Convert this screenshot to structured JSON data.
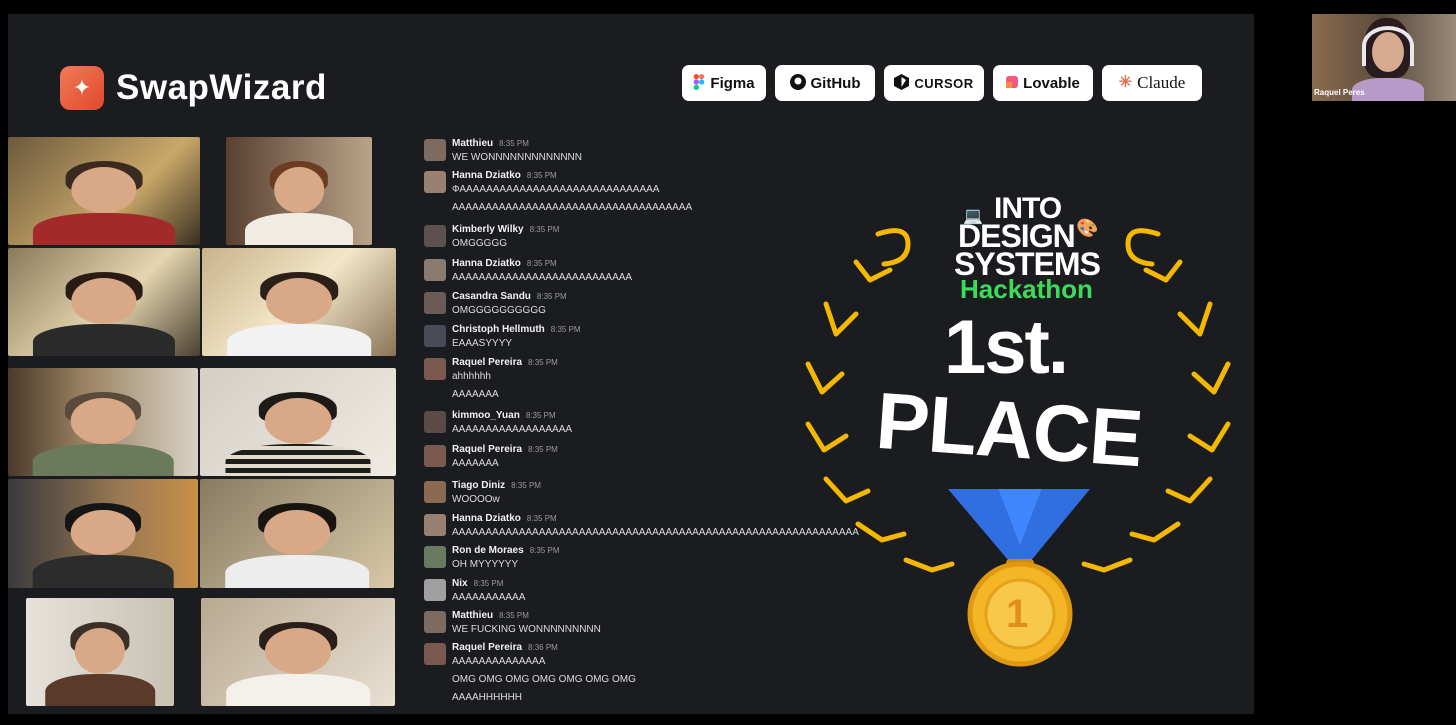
{
  "brand": {
    "name": "SwapWizard",
    "logo_icon": "magic-wand-icon",
    "accent": "#e8583a"
  },
  "sponsors": [
    {
      "label": "Figma",
      "icon": "figma-icon"
    },
    {
      "label": "GitHub",
      "icon": "github-icon"
    },
    {
      "label": "CURSOR",
      "icon": "cursor-icon"
    },
    {
      "label": "Lovable",
      "icon": "lovable-icon"
    },
    {
      "label": "Claude",
      "icon": "claude-icon"
    }
  ],
  "chat": [
    {
      "name": "Matthieu",
      "time": "8:35 PM",
      "lines": [
        "WE WONNNNNNNNNNNNN"
      ]
    },
    {
      "name": "Hanna Dziatko",
      "time": "8:35 PM",
      "lines": [
        "ФАААААААААААААААААААААААААААААА",
        "AAAAAAAAAAAAAAAAAAAAAAAAAAAAAAAAAAAA"
      ]
    },
    {
      "name": "Kimberly Wilky",
      "time": "8:35 PM",
      "lines": [
        "OMGGGGG"
      ]
    },
    {
      "name": "Hanna Dziatko",
      "time": "8:35 PM",
      "lines": [
        "AAAAAAAAAAAAAAAAAAAAAAAAAAA"
      ]
    },
    {
      "name": "Casandra Sandu",
      "time": "8:35 PM",
      "lines": [
        "OMGGGGGGGGGG"
      ]
    },
    {
      "name": "Christoph Hellmuth",
      "time": "8:35 PM",
      "lines": [
        "EAAASYYYY"
      ]
    },
    {
      "name": "Raquel Pereira",
      "time": "8:35 PM",
      "lines": [
        "ahhhhhh",
        "AAAAAAA"
      ]
    },
    {
      "name": "kimmoo_Yuan",
      "time": "8:35 PM",
      "lines": [
        "AAAAAAAAAAAAAAAAAA"
      ]
    },
    {
      "name": "Raquel Pereira",
      "time": "8:35 PM",
      "lines": [
        "AAAAAAA"
      ]
    },
    {
      "name": "Tiago Diniz",
      "time": "8:35 PM",
      "lines": [
        "WOOOOw"
      ]
    },
    {
      "name": "Hanna Dziatko",
      "time": "8:35 PM",
      "lines": [
        "AAAAAAAAAAAAAAAAAAAAAAAAAAAAAAAAAAAAAAAAAAAAAAAAAAAAAAAAAAAAA"
      ]
    },
    {
      "name": "Ron de Moraes",
      "time": "8:35 PM",
      "lines": [
        "OH MYYYYYY"
      ]
    },
    {
      "name": "Nix",
      "time": "8:35 PM",
      "lines": [
        "AAAAAAAAAAA"
      ]
    },
    {
      "name": "Matthieu",
      "time": "8:35 PM",
      "lines": [
        "WE FUCKING WONNNNNNNNN"
      ]
    },
    {
      "name": "Raquel Pereira",
      "time": "8:36 PM",
      "lines": [
        "AAAAAAAAAAAAAA",
        "OMG OMG OMG OMG OMG OMG OMG",
        "AAAAHHHHHH"
      ]
    }
  ],
  "award": {
    "line1": "INTO",
    "line2": "DESIGN",
    "line3": "SYSTEMS",
    "event": "Hackathon",
    "rank": "1st.",
    "place": "PLACE",
    "medal_number": "1",
    "colors": {
      "chevron": "#f5b800",
      "event_green": "#3ddb5a",
      "ribbon": "#2f6fe0",
      "medal": "#f4b526"
    }
  },
  "speaker": {
    "name": "Raquel Peres"
  }
}
